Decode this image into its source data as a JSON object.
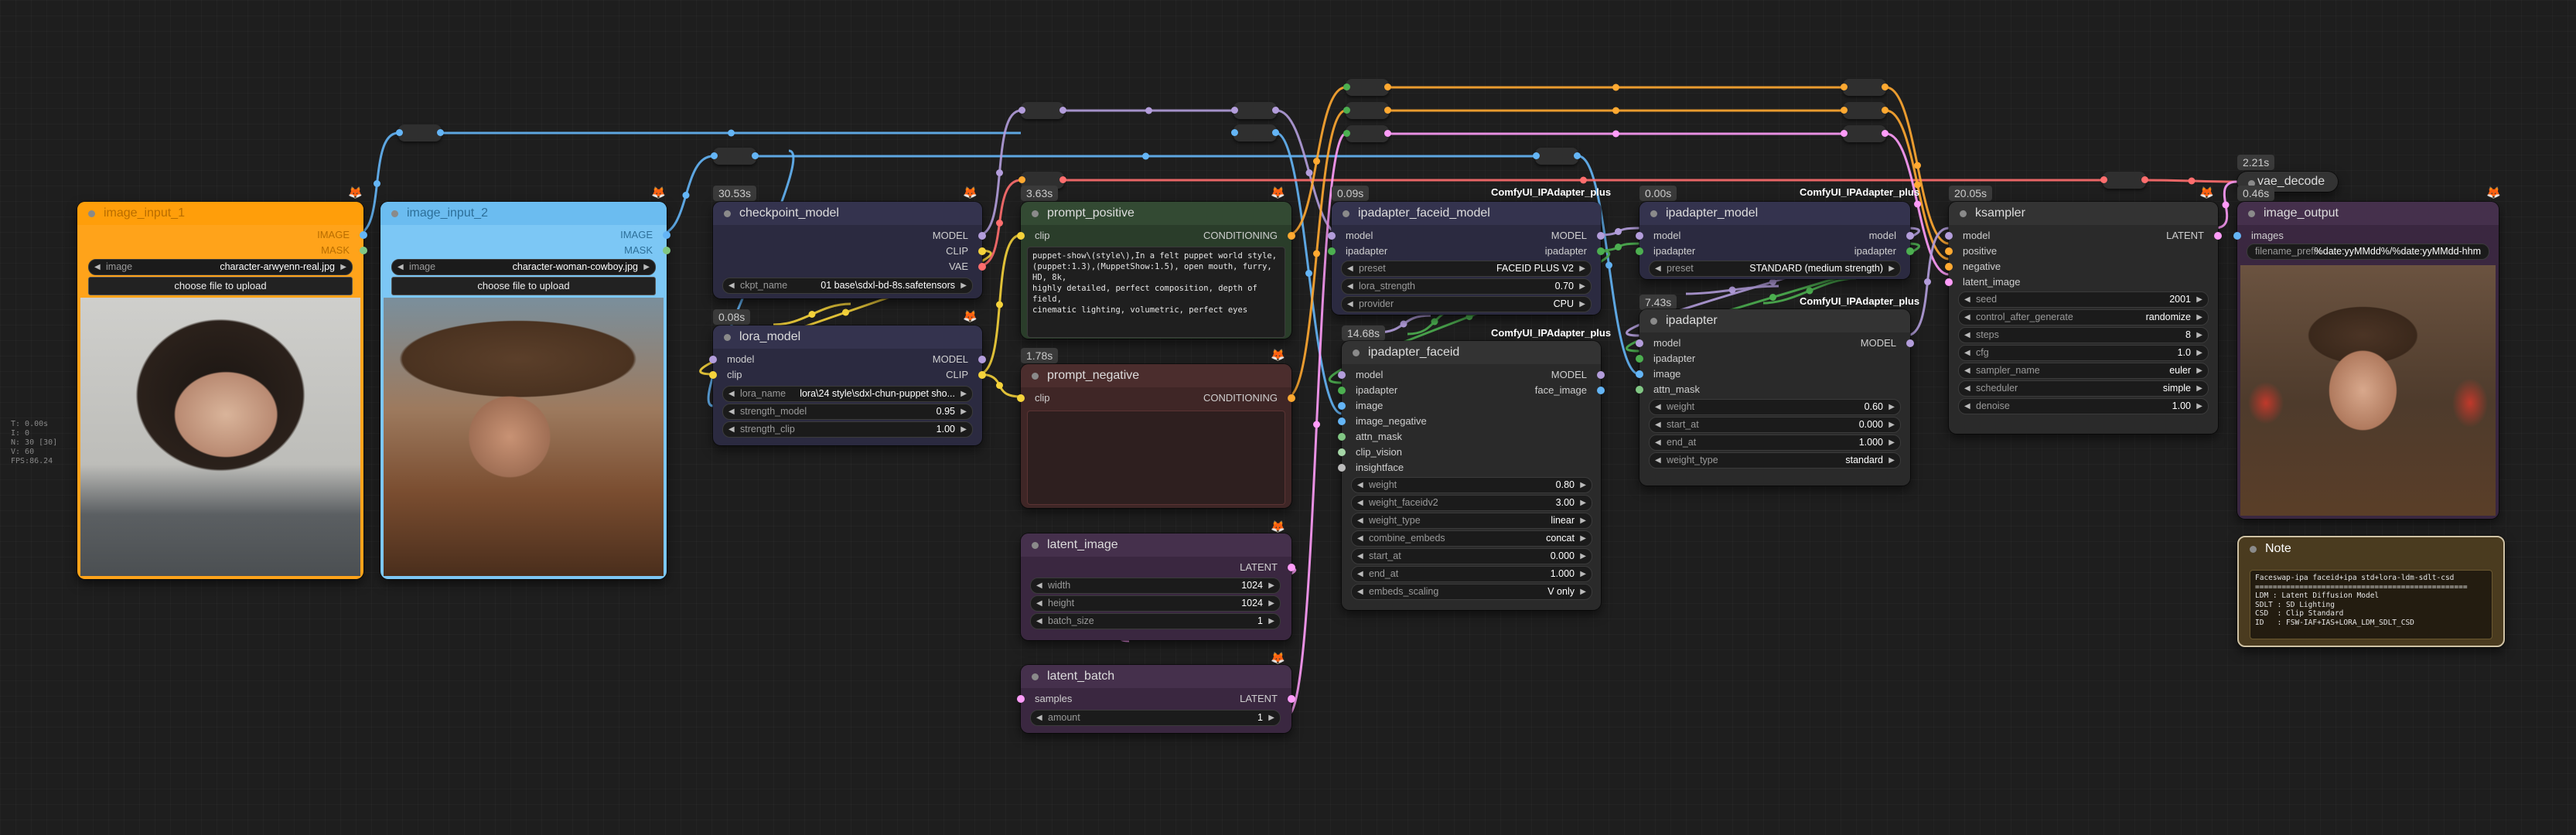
{
  "colors": {
    "model": "#b39ddb",
    "clip": "#f5d33b",
    "vae": "#ff6e6e",
    "image": "#64b5f6",
    "conditioning": "#ffa931",
    "latent": "#ff9cf9",
    "ipadapter": "#4caf50",
    "insightface": "#bdbdbd"
  },
  "stats": [
    "T: 0.00s",
    "I: 0",
    "N: 30 [30]",
    "V: 60",
    "FPS:86.24"
  ],
  "image_input_1": {
    "title": "image_input_1",
    "out_image": "IMAGE",
    "out_mask": "MASK",
    "widget_label": "image",
    "widget_value": "character-arwyenn-real.jpg",
    "upload": "choose file to upload"
  },
  "image_input_2": {
    "title": "image_input_2",
    "out_image": "IMAGE",
    "out_mask": "MASK",
    "widget_label": "image",
    "widget_value": "character-woman-cowboy.jpg",
    "upload": "choose file to upload"
  },
  "checkpoint_model": {
    "timing": "30.53s",
    "title": "checkpoint_model",
    "outs": [
      "MODEL",
      "CLIP",
      "VAE"
    ],
    "widget_label": "ckpt_name",
    "widget_value": "01 base\\sdxl-bd-8s.safetensors"
  },
  "lora_model": {
    "timing": "0.08s",
    "title": "lora_model",
    "ins": [
      "model",
      "clip"
    ],
    "outs": [
      "MODEL",
      "CLIP"
    ],
    "widgets": [
      {
        "label": "lora_name",
        "value": "lora\\24 style\\sdxl-chun-puppet sho..."
      },
      {
        "label": "strength_model",
        "value": "0.95"
      },
      {
        "label": "strength_clip",
        "value": "1.00"
      }
    ]
  },
  "prompt_positive": {
    "timing": "3.63s",
    "title": "prompt_positive",
    "in": "clip",
    "out": "CONDITIONING",
    "text": "puppet-show\\(style\\),In a felt puppet world style,\n(puppet:1.3),(MuppetShow:1.5), open mouth, furry, HD, 8k,\nhighly detailed, perfect composition, depth of field,\ncinematic lighting, volumetric, perfect eyes"
  },
  "prompt_negative": {
    "timing": "1.78s",
    "title": "prompt_negative",
    "in": "clip",
    "out": "CONDITIONING",
    "text": ""
  },
  "latent_image": {
    "title": "latent_image",
    "out": "LATENT",
    "widgets": [
      {
        "label": "width",
        "value": "1024"
      },
      {
        "label": "height",
        "value": "1024"
      },
      {
        "label": "batch_size",
        "value": "1"
      }
    ]
  },
  "latent_batch": {
    "title": "latent_batch",
    "in": "samples",
    "out": "LATENT",
    "widgets": [
      {
        "label": "amount",
        "value": "1"
      }
    ]
  },
  "ipadapter_faceid_model": {
    "timing": "0.09s",
    "pack": "ComfyUI_IPAdapter_plus",
    "title": "ipadapter_faceid_model",
    "ins": [
      "model",
      "ipadapter"
    ],
    "outs": [
      "MODEL",
      "ipadapter"
    ],
    "widgets": [
      {
        "label": "preset",
        "value": "FACEID PLUS V2"
      },
      {
        "label": "lora_strength",
        "value": "0.70"
      },
      {
        "label": "provider",
        "value": "CPU"
      }
    ]
  },
  "ipadapter_faceid": {
    "timing": "14.68s",
    "pack": "ComfyUI_IPAdapter_plus",
    "title": "ipadapter_faceid",
    "ins": [
      "model",
      "ipadapter",
      "image",
      "image_negative",
      "attn_mask",
      "clip_vision",
      "insightface"
    ],
    "outs": [
      "MODEL",
      "face_image"
    ],
    "widgets": [
      {
        "label": "weight",
        "value": "0.80"
      },
      {
        "label": "weight_faceidv2",
        "value": "3.00"
      },
      {
        "label": "weight_type",
        "value": "linear"
      },
      {
        "label": "combine_embeds",
        "value": "concat"
      },
      {
        "label": "start_at",
        "value": "0.000"
      },
      {
        "label": "end_at",
        "value": "1.000"
      },
      {
        "label": "embeds_scaling",
        "value": "V only"
      }
    ]
  },
  "ipadapter_model": {
    "timing": "0.00s",
    "pack": "ComfyUI_IPAdapter_plus",
    "title": "ipadapter_model",
    "ins": [
      "model",
      "ipadapter"
    ],
    "outs": [
      "model",
      "ipadapter"
    ],
    "widgets": [
      {
        "label": "preset",
        "value": "STANDARD (medium strength)"
      }
    ]
  },
  "ipadapter": {
    "timing": "7.43s",
    "pack": "ComfyUI_IPAdapter_plus",
    "title": "ipadapter",
    "ins": [
      "model",
      "ipadapter",
      "image",
      "attn_mask"
    ],
    "outs": [
      "MODEL"
    ],
    "widgets": [
      {
        "label": "weight",
        "value": "0.60"
      },
      {
        "label": "start_at",
        "value": "0.000"
      },
      {
        "label": "end_at",
        "value": "1.000"
      },
      {
        "label": "weight_type",
        "value": "standard"
      }
    ]
  },
  "ksampler": {
    "timing": "20.05s",
    "title": "ksampler",
    "ins": [
      "model",
      "positive",
      "negative",
      "latent_image"
    ],
    "outs": [
      "LATENT"
    ],
    "widgets": [
      {
        "label": "seed",
        "value": "2001"
      },
      {
        "label": "control_after_generate",
        "value": "randomize"
      },
      {
        "label": "steps",
        "value": "8"
      },
      {
        "label": "cfg",
        "value": "1.0"
      },
      {
        "label": "sampler_name",
        "value": "euler"
      },
      {
        "label": "scheduler",
        "value": "simple"
      },
      {
        "label": "denoise",
        "value": "1.00"
      }
    ]
  },
  "vae_decode": {
    "timing": "2.21s",
    "title": "vae_decode"
  },
  "image_output": {
    "timing": "0.46s",
    "title": "image_output",
    "in": "images",
    "widget_label": "filename_prefix",
    "widget_value": "%date:yyMMdd%/%date:yyMMdd-hhm"
  },
  "note": {
    "title": "Note",
    "text": "Faceswap-ipa faceid+ipa std+lora-ldm-sdlt-csd\n================================================\nLDM : Latent Diffusion Model\nSDLT : SD Lighting\nCSD  : Clip Standard\nID   : FSW-IAF+IAS+LORA_LDM_SDLT_CSD"
  }
}
